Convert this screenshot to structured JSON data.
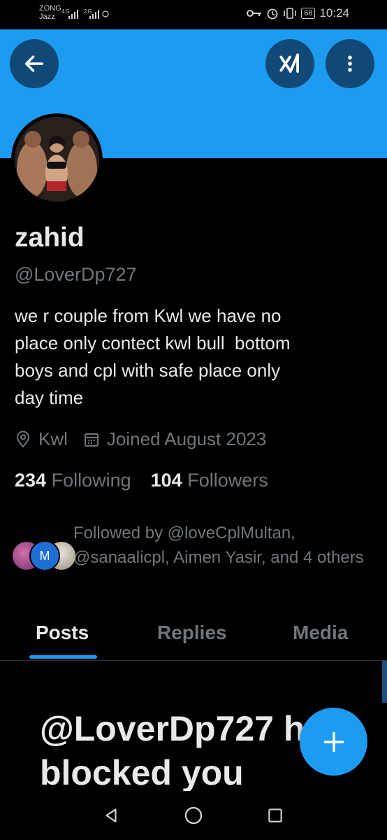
{
  "status_bar": {
    "carrier_1": "ZONG",
    "network_1": "4G",
    "carrier_2": "Jazz",
    "network_2": "2G",
    "battery": "68",
    "time": "10:24"
  },
  "header": {
    "back_icon": "arrow-left-icon",
    "grok_icon": "grok-icon",
    "more_icon": "more-vertical-icon",
    "banner_color": "#1d9bf0"
  },
  "profile": {
    "name": "zahid",
    "handle": "@LoverDp727",
    "bio": "we r couple from Kwl we have no\nplace only contect kwl bull  bottom\nboys and cpl with safe place only\nday time",
    "location": "Kwl",
    "joined": "Joined August 2023",
    "following_count": "234",
    "following_label": "Following",
    "followers_count": "104",
    "followers_label": "Followers",
    "followed_by": "Followed by @loveCplMultan, @sanaalicpl, Aimen Yasir, and 4 others",
    "follower_avatar_2_letter": "M"
  },
  "tabs": [
    {
      "label": "Posts",
      "active": true
    },
    {
      "label": "Replies",
      "active": false
    },
    {
      "label": "Media",
      "active": false
    }
  ],
  "blocked_message": "@LoverDp727 h\nblocked you",
  "fab": {
    "icon": "plus-icon"
  },
  "nav": {
    "back_icon": "triangle-back-icon",
    "home_icon": "circle-home-icon",
    "recents_icon": "square-recents-icon"
  }
}
